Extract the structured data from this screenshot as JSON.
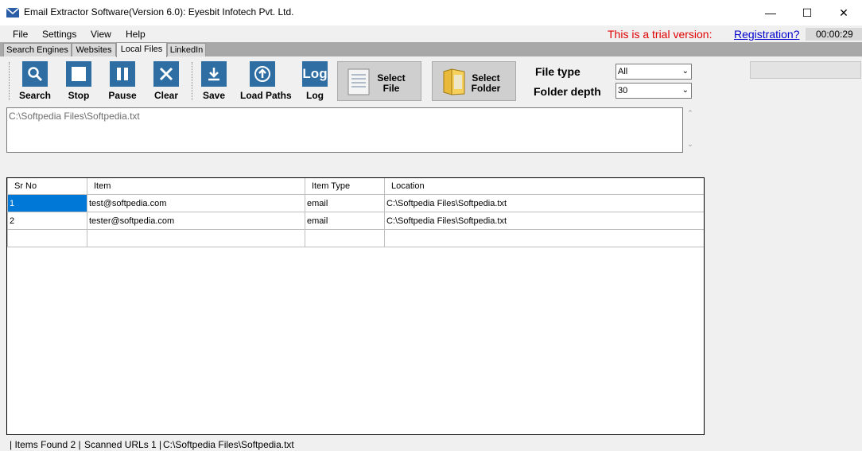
{
  "window": {
    "title": "Email Extractor Software(Version 6.0): Eyesbit Infotech Pvt. Ltd.",
    "minimize": "—",
    "maximize": "☐",
    "close": "✕"
  },
  "menu": {
    "items": [
      "File",
      "Settings",
      "View",
      "Help"
    ]
  },
  "trial_text": "This is a trial version:",
  "registration_link": "Registration?",
  "timer": "00:00:29",
  "tabs": [
    "Search Engines",
    "Websites",
    "Local Files",
    "LinkedIn"
  ],
  "active_tab": "Local Files",
  "toolbar": {
    "buttons": [
      {
        "label": "Search",
        "icon": "magnifier-icon"
      },
      {
        "label": "Stop",
        "icon": "stop-icon"
      },
      {
        "label": "Pause",
        "icon": "pause-icon"
      },
      {
        "label": "Clear",
        "icon": "x-icon"
      },
      {
        "label": "Save",
        "icon": "download-icon"
      },
      {
        "label": "Load Paths",
        "icon": "upload-icon"
      },
      {
        "label": "Log",
        "icon_text": "Log"
      }
    ],
    "select_file": "Select File",
    "select_folder": "Select Folder",
    "file_type_label": "File type",
    "file_type_value": "All",
    "folder_depth_label": "Folder depth",
    "folder_depth_value": "30"
  },
  "path_input": "C:\\Softpedia Files\\Softpedia.txt",
  "grid": {
    "columns": [
      "Sr No",
      "Item",
      "Item Type",
      "Location"
    ],
    "rows": [
      {
        "sr": "1",
        "item": "test@softpedia.com",
        "type": "email",
        "location": "C:\\Softpedia Files\\Softpedia.txt"
      },
      {
        "sr": "2",
        "item": "tester@softpedia.com",
        "type": "email",
        "location": "C:\\Softpedia Files\\Softpedia.txt"
      }
    ]
  },
  "status": {
    "items_found": "| Items Found 2 |",
    "scanned": "Scanned URLs 1 |",
    "current": "C:\\Softpedia Files\\Softpedia.txt"
  },
  "colors": {
    "accent": "#2f6ea3",
    "trial": "#e00000",
    "link": "#0000cc",
    "selection": "#0078d7"
  }
}
